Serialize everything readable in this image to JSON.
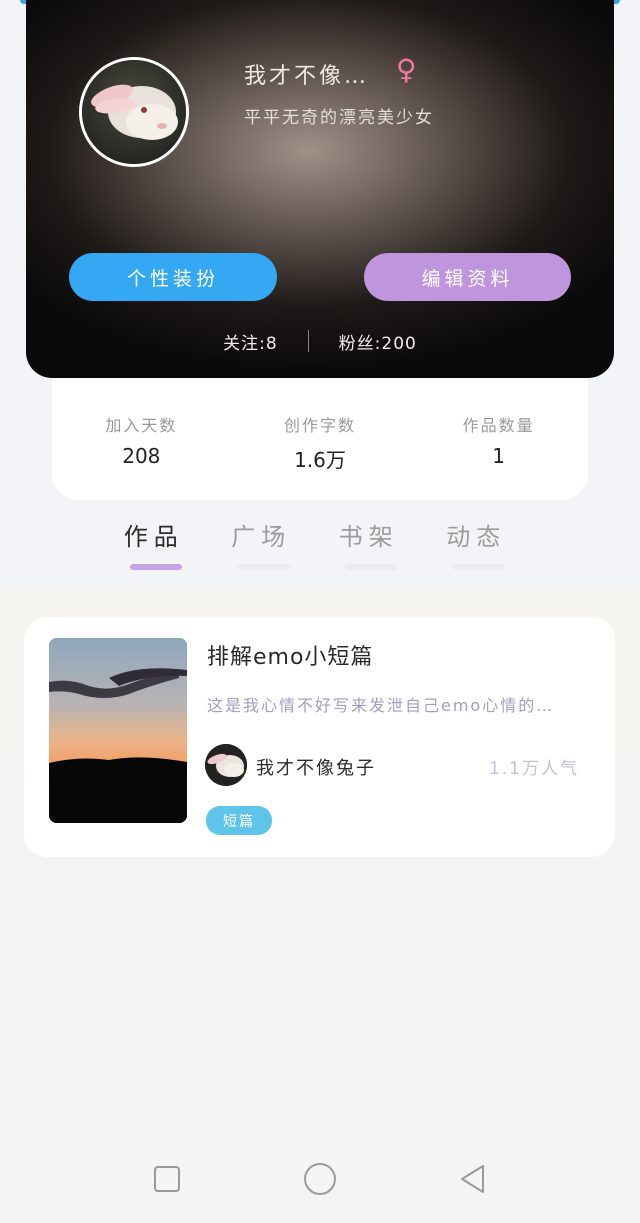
{
  "profile": {
    "nickname": "我才不像…",
    "gender_icon": "female-icon",
    "gender_symbol": "♀",
    "signature": "平平无奇的漂亮美少女",
    "buttons": {
      "dress_up": "个性装扮",
      "edit_profile": "编辑资料"
    },
    "following": "关注:8",
    "followers": "粉丝:200"
  },
  "stats": [
    {
      "label": "加入天数",
      "value": "208"
    },
    {
      "label": "创作字数",
      "value": "1.6万"
    },
    {
      "label": "作品数量",
      "value": "1"
    }
  ],
  "tabs": [
    {
      "label": "作品",
      "active": true
    },
    {
      "label": "广场",
      "active": false
    },
    {
      "label": "书架",
      "active": false
    },
    {
      "label": "动态",
      "active": false
    }
  ],
  "works": [
    {
      "title": "排解emo小短篇",
      "description": "这是我心情不好写来发泄自己emo心情的…",
      "author": "我才不像兔子",
      "popularity": "1.1万人气",
      "tag": "短篇"
    }
  ],
  "navbar": {
    "icons": [
      "recent-apps-icon",
      "home-icon",
      "back-icon"
    ]
  },
  "colors": {
    "accent_blue": "#35a8f4",
    "accent_purple": "#bf95dd",
    "tag_blue": "#5ec4ea",
    "gender_pink": "#f07aa0"
  }
}
